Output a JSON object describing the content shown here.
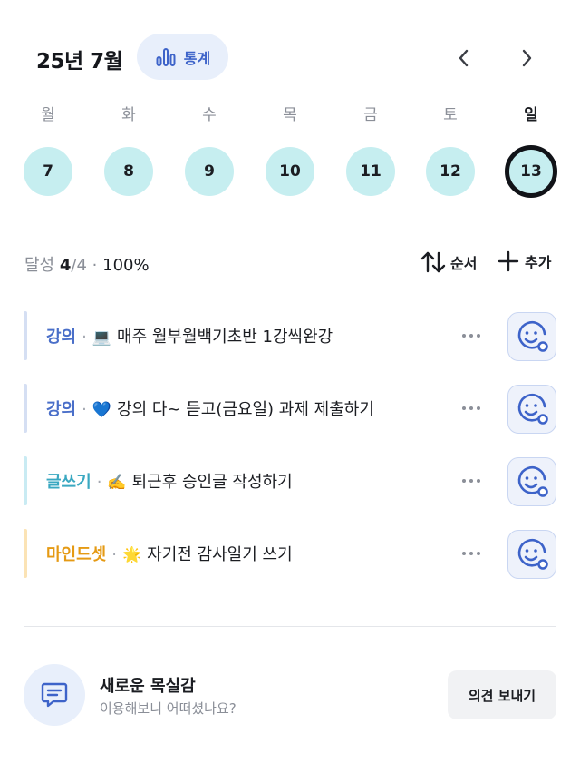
{
  "header": {
    "month_title": "25년 7월",
    "stats_label": "통계"
  },
  "week": {
    "days": [
      {
        "name": "월",
        "date": "7",
        "today": false
      },
      {
        "name": "화",
        "date": "8",
        "today": false
      },
      {
        "name": "수",
        "date": "9",
        "today": false
      },
      {
        "name": "목",
        "date": "10",
        "today": false
      },
      {
        "name": "금",
        "date": "11",
        "today": false
      },
      {
        "name": "토",
        "date": "12",
        "today": false
      },
      {
        "name": "일",
        "date": "13",
        "today": true
      }
    ]
  },
  "summary": {
    "label": "달성",
    "count": "4",
    "total": "/4",
    "separator": "·",
    "percent": "100%"
  },
  "actions": {
    "sort_label": "순서",
    "add_label": "추가"
  },
  "tasks": [
    {
      "category": "강의",
      "emoji": "💻",
      "title": "매주 월부월백기초반 1강씩완강",
      "color": "#4a6fc9",
      "bar_color": "#d5dff3"
    },
    {
      "category": "강의",
      "emoji": "💙",
      "title": "강의 다~ 듣고(금요일) 과제 제출하기",
      "color": "#4a6fc9",
      "bar_color": "#d5dff3"
    },
    {
      "category": "글쓰기",
      "emoji": "✍️",
      "title": "퇴근후 승인글 작성하기",
      "color": "#3aa8c1",
      "bar_color": "#c9ebf3"
    },
    {
      "category": "마인드셋",
      "emoji": "🌟",
      "title": "자기전 감사일기 쓰기",
      "color": "#e59a14",
      "bar_color": "#fbe3b5"
    }
  ],
  "feedback": {
    "title": "새로운 목실감",
    "subtitle": "이용해보니 어떠셨나요?",
    "button_label": "의견 보내기"
  },
  "colors": {
    "accent": "#3d63c9",
    "day_circle": "#c6eef0",
    "today_ring": "#111318"
  }
}
